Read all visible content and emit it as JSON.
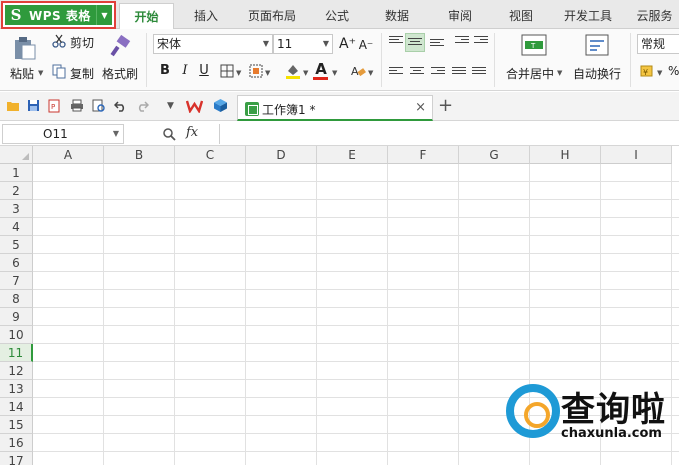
{
  "app": {
    "wps_button_label": "WPS 表格",
    "wps_logo_glyph": "S",
    "accent_color": "#2f9a3c",
    "highlight_color": "#e0403a"
  },
  "tabs": [
    {
      "label": "开始",
      "active": true
    },
    {
      "label": "插入"
    },
    {
      "label": "页面布局"
    },
    {
      "label": "公式"
    },
    {
      "label": "数据"
    },
    {
      "label": "审阅"
    },
    {
      "label": "视图"
    },
    {
      "label": "开发工具"
    },
    {
      "label": "云服务"
    }
  ],
  "ribbon": {
    "clipboard": {
      "paste": "粘贴",
      "cut": "剪切",
      "copy": "复制",
      "format_painter": "格式刷"
    },
    "font": {
      "name": "宋体",
      "size": "11",
      "bold": "B",
      "italic": "I",
      "underline": "U",
      "grow": "A⁺",
      "shrink": "A⁻",
      "font_color_glyph": "A"
    },
    "alignment": {
      "merge_center": "合并居中",
      "wrap_text": "自动换行"
    },
    "number": {
      "format": "常规",
      "percent": "%"
    }
  },
  "document_tab": {
    "name": "工作簿1 *",
    "close_glyph": "×",
    "add_glyph": "+"
  },
  "formula_bar": {
    "cell_ref": "O11",
    "fx_label": "fx",
    "value": ""
  },
  "sheet": {
    "columns": [
      "A",
      "B",
      "C",
      "D",
      "E",
      "F",
      "G",
      "H",
      "I"
    ],
    "rows": [
      "1",
      "2",
      "3",
      "4",
      "5",
      "6",
      "7",
      "8",
      "9",
      "10",
      "11",
      "12",
      "13",
      "14",
      "15",
      "16",
      "17"
    ],
    "active_row": "11"
  },
  "watermark": {
    "title": "查询啦",
    "subtitle": "chaxunla.com"
  }
}
